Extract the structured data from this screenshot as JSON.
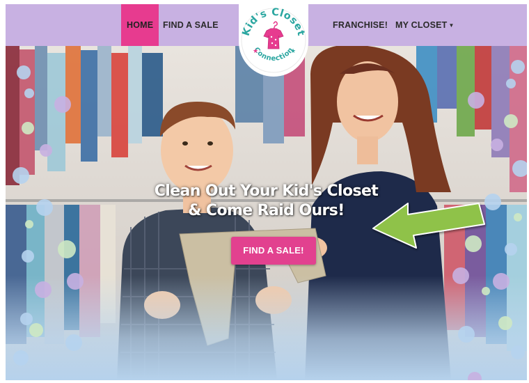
{
  "nav": {
    "home": "HOME",
    "find_sale": "FIND A SALE",
    "franchise": "FRANCHISE!",
    "my_closet": "MY CLOSET"
  },
  "logo": {
    "text": "Kid's Closet Connection",
    "primary_color": "#e73b8f",
    "secondary_color": "#2aa6a0"
  },
  "hero": {
    "headline_line1": "Clean Out Your Kid's Closet",
    "headline_line2": "& Come Raid Ours!",
    "cta_label": "FIND A SALE!"
  },
  "colors": {
    "nav_bg": "#c8b1e2",
    "active_tab": "#e73b8f",
    "cta": "#e2418f",
    "arrow": "#8fc24a"
  }
}
